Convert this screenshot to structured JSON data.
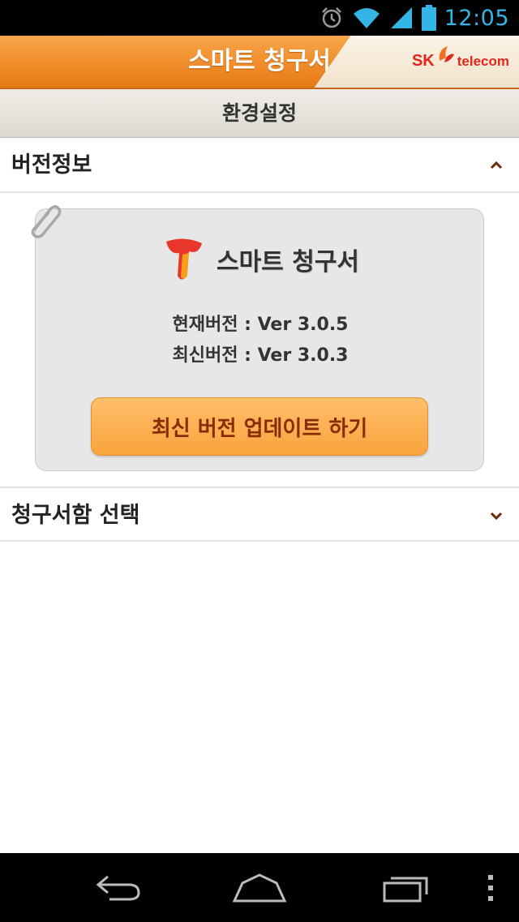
{
  "status_bar": {
    "time": "12:05",
    "icons": [
      "alarm-icon",
      "wifi-icon",
      "signal-icon",
      "battery-icon"
    ],
    "accent_color": "#33b5e5"
  },
  "app_header": {
    "title": "스마트 청구서",
    "brand_sk": "SK",
    "brand_telecom": "telecom",
    "color": "#ef8a26"
  },
  "sub_header": {
    "title": "환경설정"
  },
  "sections": {
    "version_info": {
      "label": "버전정보",
      "expanded": true
    },
    "bill_box": {
      "label": "청구서함 선택",
      "expanded": false
    }
  },
  "version_card": {
    "logo_text": "스마트 청구서",
    "current_version": "현재버전 : Ver 3.0.5",
    "latest_version": "최신버전 : Ver 3.0.3",
    "update_button": "최신 버전 업데이트 하기",
    "button_color": "#f9a33d"
  },
  "nav_bar": {
    "buttons": [
      "back-icon",
      "home-icon",
      "recent-apps-icon",
      "menu-icon"
    ]
  }
}
